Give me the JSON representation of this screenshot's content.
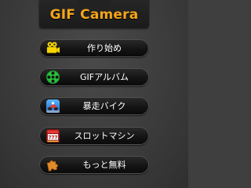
{
  "header": {
    "title": "GIF Camera",
    "title_color": "#f4a51c"
  },
  "menu": {
    "items": [
      {
        "label": "作り始め",
        "icon": "video-camera-icon"
      },
      {
        "label": "GIFアルバム",
        "icon": "film-reel-icon"
      },
      {
        "label": "暴走バイク",
        "icon": "motorbike-app-icon"
      },
      {
        "label": "スロットマシン",
        "icon": "slot-machine-icon"
      },
      {
        "label": "もっと無料",
        "icon": "puzzle-piece-icon"
      }
    ]
  },
  "colors": {
    "background": "#3f3f3f",
    "button": "#141414",
    "button_text": "#ffffff",
    "icon_yellow": "#f5d400",
    "icon_green": "#29c23a",
    "icon_orange": "#e08a2a"
  }
}
